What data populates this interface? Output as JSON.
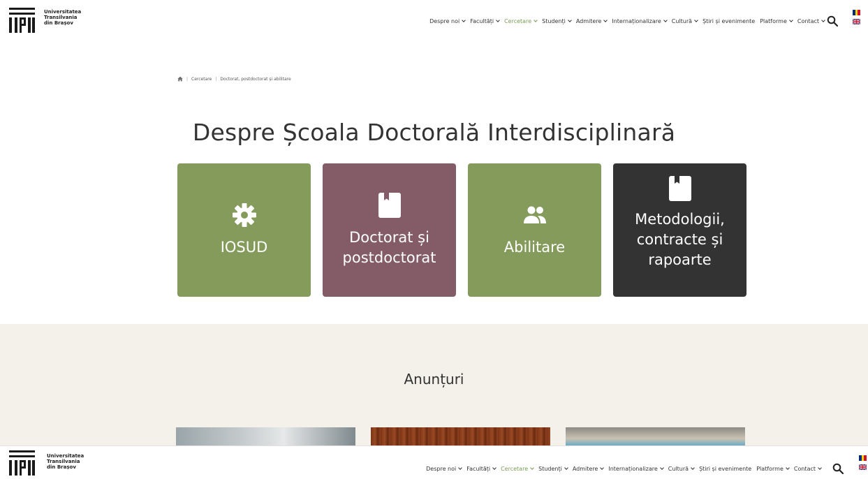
{
  "brand": {
    "name": "Universitatea\nTransilvania\ndin Brașov"
  },
  "nav": {
    "items": [
      {
        "label": "Despre noi",
        "active": false
      },
      {
        "label": "Facultăți",
        "active": false
      },
      {
        "label": "Cercetare",
        "active": true
      },
      {
        "label": "Studenți",
        "active": false
      },
      {
        "label": "Admitere",
        "active": false
      },
      {
        "label": "Internaționalizare",
        "active": false
      },
      {
        "label": "Cultură",
        "active": false
      },
      {
        "label": "Știri și evenimente",
        "active": false,
        "no_chevron": true
      },
      {
        "label": "Platforme",
        "active": false
      },
      {
        "label": "Contact",
        "active": false
      }
    ]
  },
  "breadcrumb": {
    "items": [
      "Cercetare",
      "Doctorat, postdoctorat și abilitare"
    ]
  },
  "page": {
    "title": "Despre Școala Doctorală Interdisciplinară"
  },
  "cards": [
    {
      "label": "IOSUD",
      "icon": "gear-icon",
      "color": "#849b5c"
    },
    {
      "label": "Doctorat și postdoctorat",
      "icon": "bookmark-icon",
      "color": "#845c68"
    },
    {
      "label": "Abilitare",
      "icon": "users-icon",
      "color": "#849b5c"
    },
    {
      "label": "Metodologii, contracte și rapoarte",
      "icon": "bookmark-icon",
      "color": "#333333"
    }
  ],
  "announcements": {
    "title": "Anunțuri"
  },
  "colors": {
    "accent_green": "#849b5c",
    "accent_mauve": "#845c68",
    "dark": "#333333",
    "announcement_bg": "#f4f0ea"
  }
}
